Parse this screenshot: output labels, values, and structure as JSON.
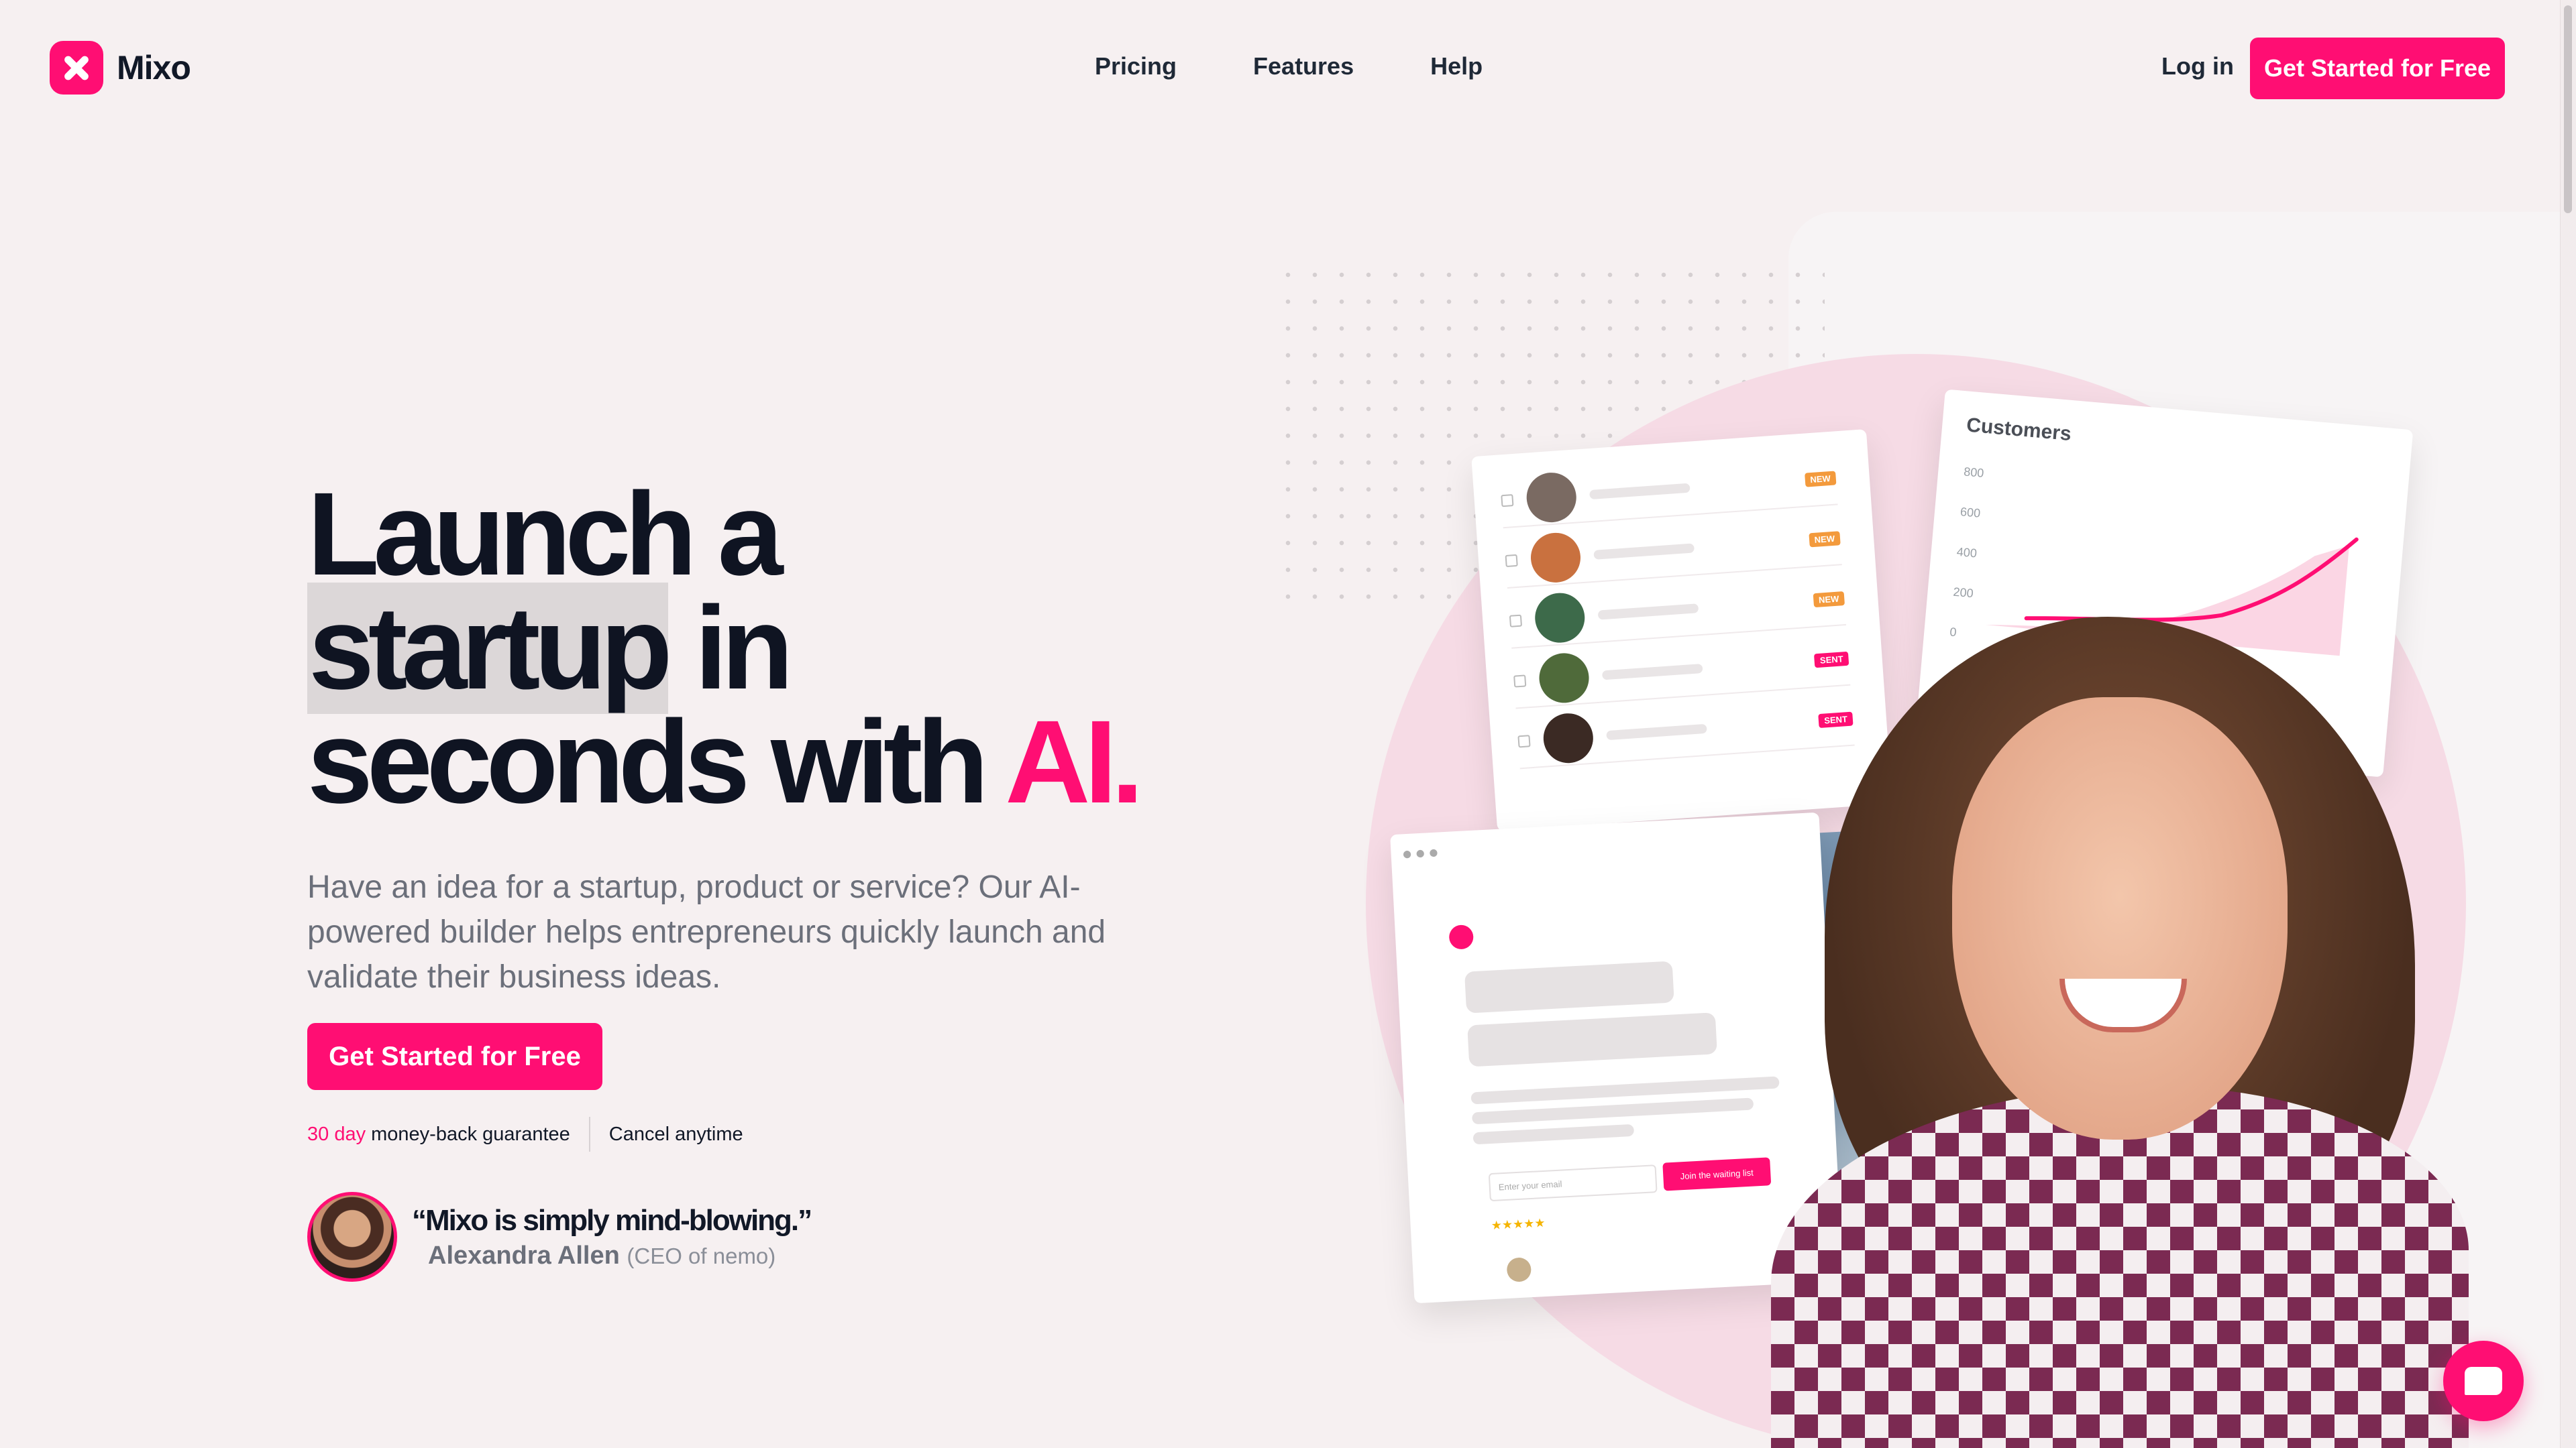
{
  "brand": {
    "name": "Mixo",
    "accent": "#ff0e73"
  },
  "nav": {
    "links": [
      "Pricing",
      "Features",
      "Help"
    ],
    "login": "Log in",
    "cta": "Get Started for Free"
  },
  "hero": {
    "title_line1": "Launch a",
    "title_highlight": "startup",
    "title_line2_rest": "in",
    "title_line3_main": "seconds with",
    "title_line3_accent": "AI.",
    "subtitle": "Have an idea for a startup, product or service? Our AI-powered builder helps entrepreneurs quickly launch and validate their business ideas.",
    "cta": "Get Started for Free",
    "guarantee_days": "30 day",
    "guarantee_text": "money-back guarantee",
    "cancel_text": "Cancel anytime"
  },
  "testimonial": {
    "quote": "“Mixo is simply mind-blowing.”",
    "author": "Alexandra Allen",
    "role": "(CEO of nemo)"
  },
  "illustration": {
    "chart_title": "Customers",
    "chart_ticks": [
      "800",
      "600",
      "400",
      "200",
      "0"
    ],
    "list_badges": [
      "NEW",
      "NEW",
      "NEW",
      "SENT",
      "SENT"
    ],
    "email_placeholder": "Enter your email",
    "waitlist_button": "Join the waiting list",
    "stars": "★★★★★"
  },
  "icons": {
    "logo": "mixo-x-icon",
    "chat": "chat-bubble-icon"
  }
}
